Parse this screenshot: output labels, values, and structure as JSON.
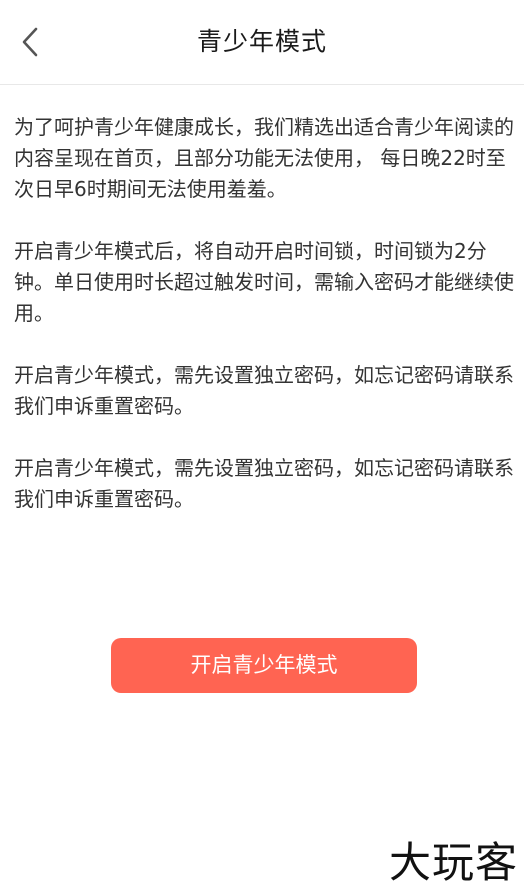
{
  "header": {
    "title": "青少年模式",
    "back_icon": "chevron-left-icon"
  },
  "content": {
    "paragraphs": [
      "为了呵护青少年健康成长，我们精选出适合青少年阅读的内容呈现在首页，且部分功能无法使用， 每日晚22时至次日早6时期间无法使用羞羞。",
      "开启青少年模式后，将自动开启时间锁，时间锁为2分钟。单日使用时长超过触发时间，需输入密码才能继续使用。",
      "开启青少年模式，需先设置独立密码，如忘记密码请联系我们申诉重置密码。",
      "开启青少年模式，需先设置独立密码，如忘记密码请联系我们申诉重置密码。"
    ]
  },
  "cta": {
    "label": "开启青少年模式",
    "color": "#ff6452"
  },
  "watermark": {
    "text": "大玩客"
  }
}
